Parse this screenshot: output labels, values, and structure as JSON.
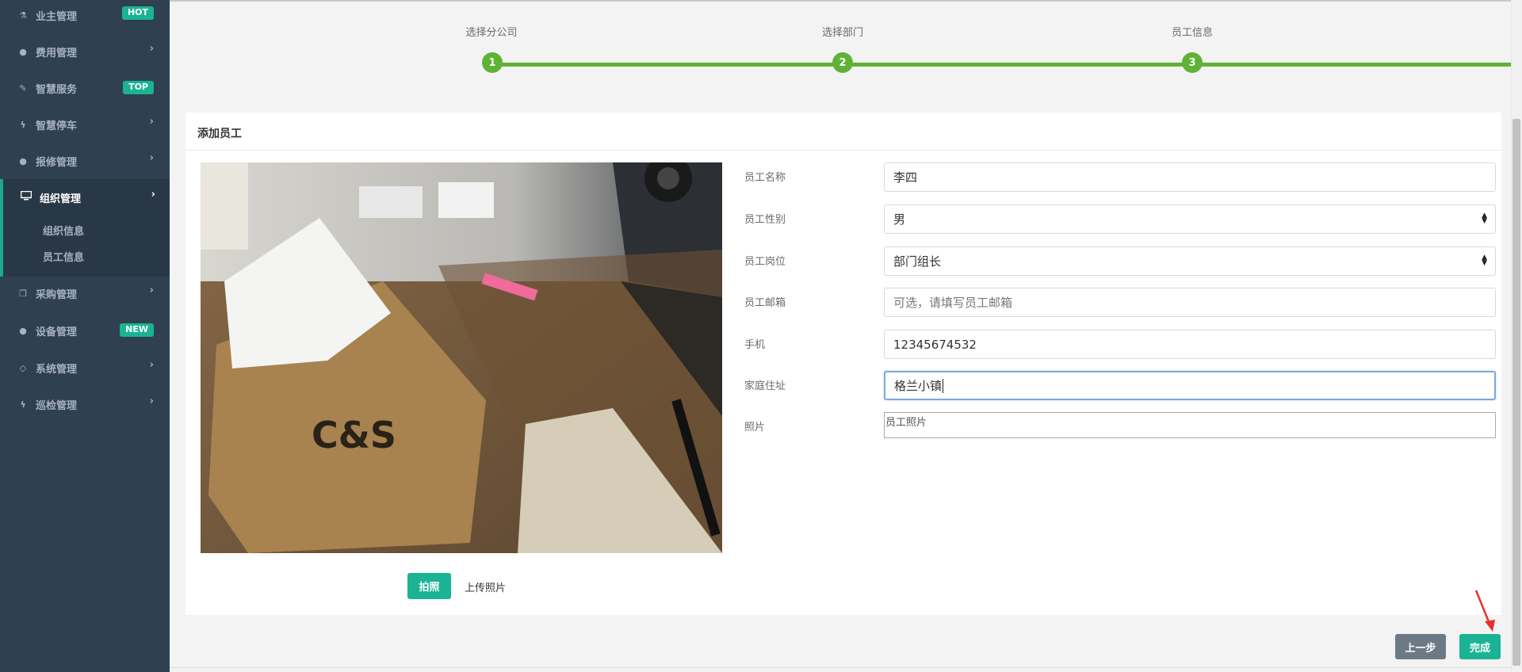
{
  "sidebar": {
    "items": [
      {
        "label": "业主管理",
        "icon": "flask-icon",
        "badge": "HOT"
      },
      {
        "label": "费用管理",
        "icon": "globe-icon"
      },
      {
        "label": "智慧服务",
        "icon": "edit-icon",
        "badge": "TOP"
      },
      {
        "label": "智慧停车",
        "icon": "bolt-icon"
      },
      {
        "label": "报修管理",
        "icon": "globe-icon"
      },
      {
        "label": "采购管理",
        "icon": "clone-icon"
      },
      {
        "label": "设备管理",
        "icon": "globe-icon",
        "badge": "NEW"
      },
      {
        "label": "系统管理",
        "icon": "diamond-icon"
      },
      {
        "label": "巡检管理",
        "icon": "bolt-icon"
      }
    ],
    "active": {
      "label": "组织管理",
      "icon": "desktop-icon",
      "subitems": [
        "组织信息",
        "员工信息"
      ]
    }
  },
  "steps": [
    {
      "label": "选择分公司",
      "number": "1"
    },
    {
      "label": "选择部门",
      "number": "2"
    },
    {
      "label": "员工信息",
      "number": "3"
    }
  ],
  "panel": {
    "title": "添加员工",
    "snap_button": "拍照",
    "upload_label": "上传照片"
  },
  "form": {
    "name": {
      "label": "员工名称",
      "value": "李四"
    },
    "gender": {
      "label": "员工性别",
      "value": "男"
    },
    "position": {
      "label": "员工岗位",
      "value": "部门组长"
    },
    "email": {
      "label": "员工邮箱",
      "placeholder": "可选，请填写员工邮箱"
    },
    "phone": {
      "label": "手机",
      "value": "12345674532"
    },
    "address": {
      "label": "家庭住址",
      "value": "格兰小镇"
    },
    "photo": {
      "label": "照片",
      "placeholder": "员工照片"
    }
  },
  "buttons": {
    "prev": "上一步",
    "done": "完成"
  },
  "colors": {
    "sidebar_bg": "#2f4050",
    "accent": "#1ab394",
    "step_green": "#5fb236",
    "arrow_red": "#e8302a"
  }
}
